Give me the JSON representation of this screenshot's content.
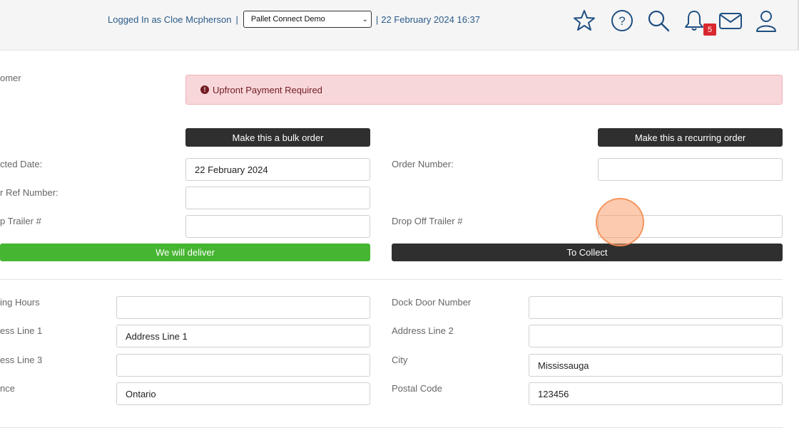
{
  "header": {
    "logged_in_text": "Logged In as Cloe Mcpherson",
    "separator": "|",
    "company_select_value": "Pallet Connect Demo",
    "datetime": "22 February 2024 16:37",
    "notifications_count": "5",
    "icons": [
      "star-icon",
      "help-icon",
      "search-icon",
      "bell-icon",
      "mail-icon",
      "user-icon"
    ]
  },
  "form": {
    "customer_label": "omer",
    "alert_text": "Upfront Payment Required",
    "bulk_order_button": "Make this a bulk order",
    "recurring_order_button": "Make this a recurring order",
    "collected_date_label": "cted Date:",
    "collected_date_value": "22 February 2024",
    "order_number_label": "Order Number:",
    "order_number_value": "",
    "customer_ref_label": "r Ref Number:",
    "customer_ref_value": "",
    "pickup_trailer_label": "p Trailer #",
    "pickup_trailer_value": "",
    "dropoff_trailer_label": "Drop Off Trailer #",
    "dropoff_trailer_value": "",
    "we_will_deliver_button": "We will deliver",
    "to_collect_button": "To Collect"
  },
  "address": {
    "opening_hours_label": "ing Hours",
    "opening_hours_value": "",
    "dock_door_label": "Dock Door Number",
    "dock_door_value": "",
    "address1_label": "ess Line 1",
    "address1_value": "Address Line 1",
    "address2_label": "Address Line 2",
    "address2_value": "",
    "address3_label": "ess Line 3",
    "address3_value": "",
    "city_label": "City",
    "city_value": "Mississauga",
    "province_label": "nce",
    "province_value": "Ontario",
    "postal_code_label": "Postal Code",
    "postal_code_value": "123456"
  },
  "colors": {
    "alert_bg": "#f8d7da",
    "alert_text": "#721c24",
    "green_button": "#46b532",
    "dark_button": "#2f2f2f",
    "header_text": "#2c5b8a",
    "badge": "#d9282f",
    "icon_blue": "#1f4f82"
  }
}
